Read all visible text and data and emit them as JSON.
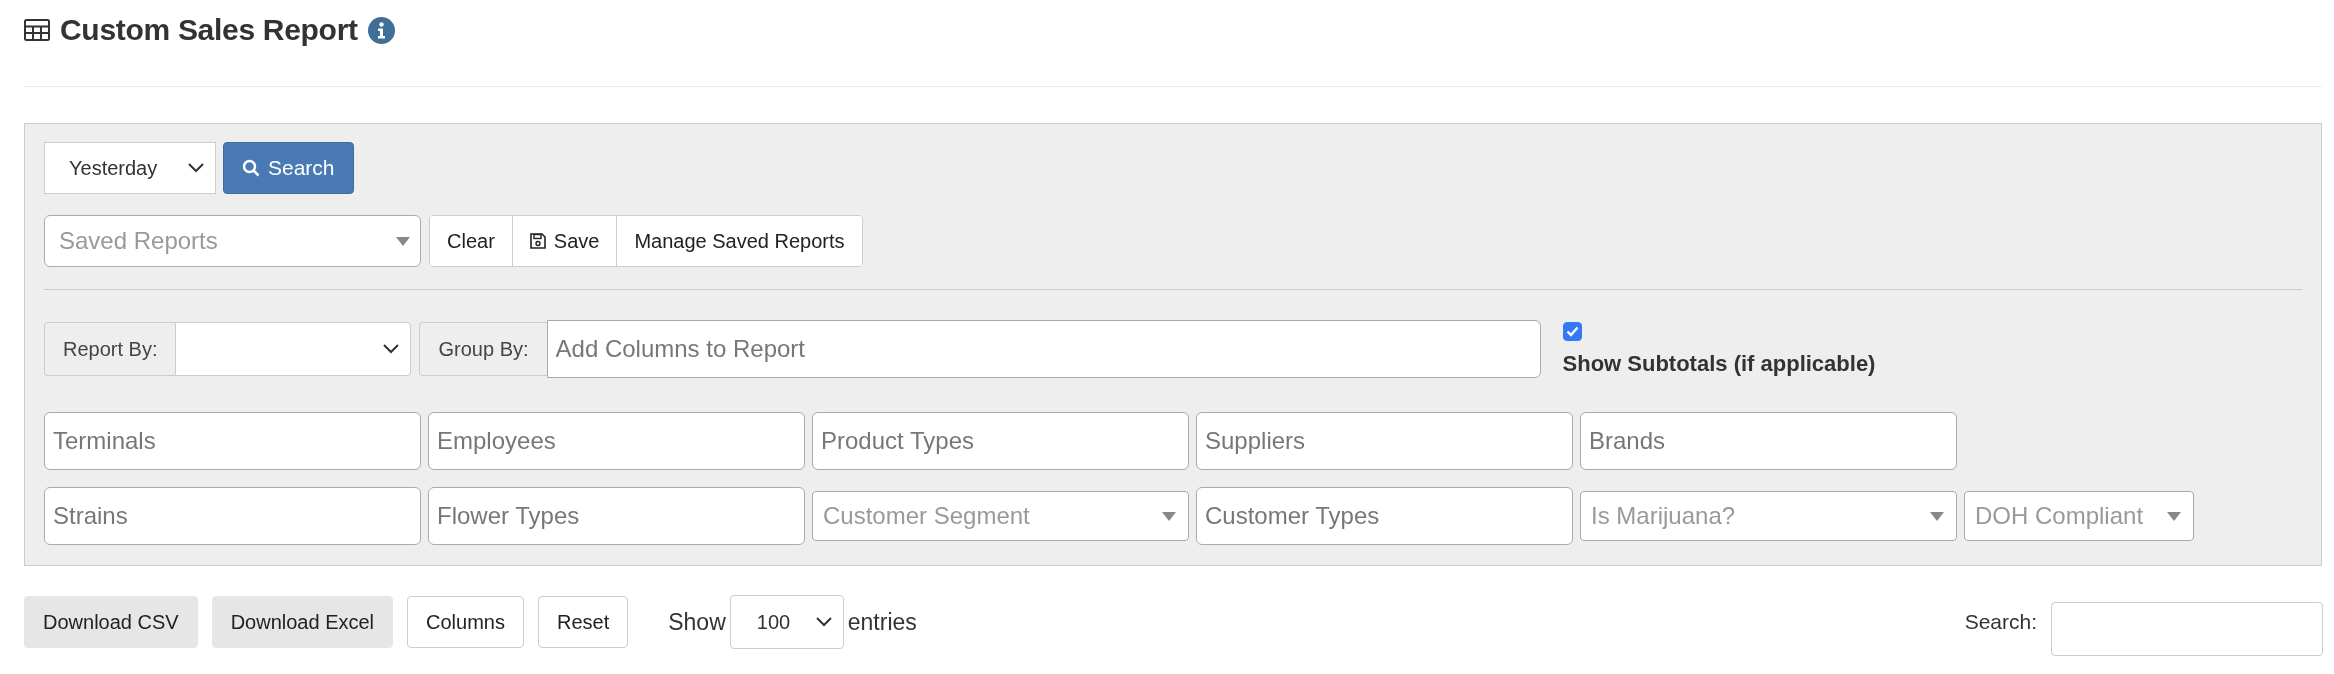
{
  "header": {
    "title": "Custom Sales Report"
  },
  "date_range": {
    "value": "Yesterday"
  },
  "search_button": {
    "label": "Search"
  },
  "saved_reports": {
    "placeholder": "Saved Reports"
  },
  "saved_actions": [
    {
      "label": "Clear",
      "has_icon": false
    },
    {
      "label": "Save",
      "has_icon": true
    },
    {
      "label": "Manage Saved Reports",
      "has_icon": false
    }
  ],
  "report_by": {
    "label": "Report By:"
  },
  "group_by": {
    "label": "Group By:",
    "placeholder": "Add Columns to Report"
  },
  "subtotals": {
    "label": "Show Subtotals (if applicable)",
    "checked": true
  },
  "filter_rows": [
    [
      {
        "kind": "tags",
        "placeholder": "Terminals"
      },
      {
        "kind": "tags",
        "placeholder": "Employees"
      },
      {
        "kind": "tags",
        "placeholder": "Product Types"
      },
      {
        "kind": "tags",
        "placeholder": "Suppliers"
      },
      {
        "kind": "tags",
        "placeholder": "Brands"
      }
    ],
    [
      {
        "kind": "tags",
        "placeholder": "Strains"
      },
      {
        "kind": "tags",
        "placeholder": "Flower Types"
      },
      {
        "kind": "select",
        "placeholder": "Customer Segment"
      },
      {
        "kind": "tags",
        "placeholder": "Customer Types"
      },
      {
        "kind": "select",
        "placeholder": "Is Marijuana?"
      },
      {
        "kind": "select-small",
        "placeholder": "DOH Compliant"
      }
    ]
  ],
  "table_actions": [
    {
      "label": "Download CSV",
      "kind": "filled"
    },
    {
      "label": "Download Excel",
      "kind": "filled"
    },
    {
      "label": "Columns",
      "kind": "outline"
    },
    {
      "label": "Reset",
      "kind": "outline"
    }
  ],
  "page_length": {
    "before": "Show",
    "value": "100",
    "after": "entries"
  },
  "table_search": {
    "label": "Search:"
  }
}
